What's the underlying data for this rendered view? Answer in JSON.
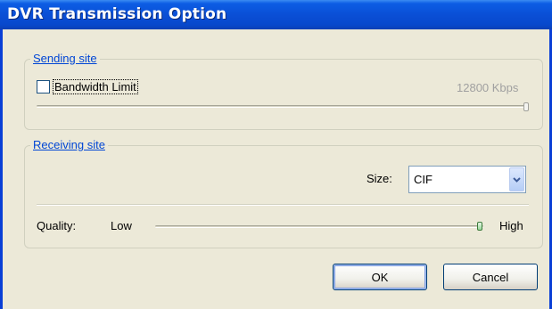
{
  "window": {
    "title": "DVR Transmission Option"
  },
  "sending_site": {
    "group_label": "Sending site",
    "bandwidth_checkbox": {
      "label": "Bandwidth Limit",
      "checked": false
    },
    "bandwidth_value": "12800 Kbps",
    "bandwidth_slider_position": 1.0
  },
  "receiving_site": {
    "group_label": "Receiving site",
    "size_label": "Size:",
    "size_value": "CIF",
    "quality_label": "Quality:",
    "quality_low": "Low",
    "quality_high": "High",
    "quality_slider_position": 1.0
  },
  "buttons": {
    "ok": "OK",
    "cancel": "Cancel"
  },
  "colors": {
    "titlebar": "#0a4fd6",
    "group_label": "#0046d5",
    "dialog_bg": "#ece9d8"
  }
}
